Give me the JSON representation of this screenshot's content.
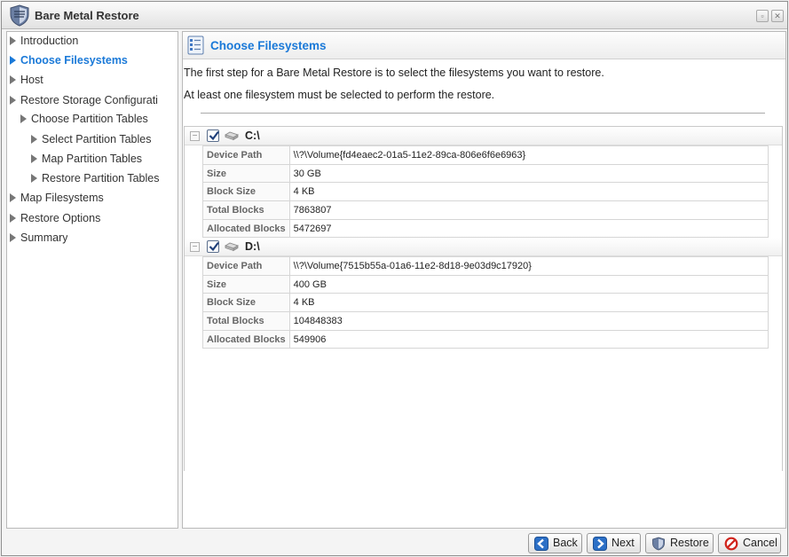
{
  "window": {
    "title": "Bare Metal Restore",
    "max_glyph": "▫",
    "close_glyph": "✕"
  },
  "icons": {
    "app": "shield-icon",
    "header": "document-list-icon",
    "disk": "disk-icon"
  },
  "sidebar": {
    "items": [
      {
        "label": "Introduction",
        "active": false
      },
      {
        "label": "Choose Filesystems",
        "active": true
      },
      {
        "label": "Host",
        "active": false
      },
      {
        "label": "Restore Storage Configurati",
        "active": false
      },
      {
        "label": "Choose Partition Tables",
        "active": false
      },
      {
        "label": "Select Partition Tables",
        "active": false
      },
      {
        "label": "Map Partition Tables",
        "active": false
      },
      {
        "label": "Restore Partition Tables",
        "active": false
      },
      {
        "label": "Map Filesystems",
        "active": false
      },
      {
        "label": "Restore Options",
        "active": false
      },
      {
        "label": "Summary",
        "active": false
      }
    ]
  },
  "main": {
    "title": "Choose Filesystems",
    "intro_1": "The first step for a Bare Metal Restore is to select the filesystems you want to restore.",
    "intro_2": "At least one filesystem must be selected to perform the restore.",
    "collapse_glyph": "−",
    "filesystems": [
      {
        "name": "C:\\",
        "checked": true,
        "props": [
          {
            "key": "Device Path",
            "value": "\\\\?\\Volume{fd4eaec2-01a5-11e2-89ca-806e6f6e6963}"
          },
          {
            "key": "Size",
            "value": "30 GB"
          },
          {
            "key": "Block Size",
            "value": "4 KB"
          },
          {
            "key": "Total Blocks",
            "value": "7863807"
          },
          {
            "key": "Allocated Blocks",
            "value": "5472697"
          }
        ]
      },
      {
        "name": "D:\\",
        "checked": true,
        "props": [
          {
            "key": "Device Path",
            "value": "\\\\?\\Volume{7515b55a-01a6-11e2-8d18-9e03d9c17920}"
          },
          {
            "key": "Size",
            "value": "400 GB"
          },
          {
            "key": "Block Size",
            "value": "4 KB"
          },
          {
            "key": "Total Blocks",
            "value": "104848383"
          },
          {
            "key": "Allocated Blocks",
            "value": "549906"
          }
        ]
      }
    ]
  },
  "buttons": {
    "back": "Back",
    "next": "Next",
    "restore": "Restore",
    "cancel": "Cancel"
  },
  "colors": {
    "accent": "#1a79d8",
    "button_blue": "#2b6fc6",
    "cancel_red": "#d0241c"
  }
}
